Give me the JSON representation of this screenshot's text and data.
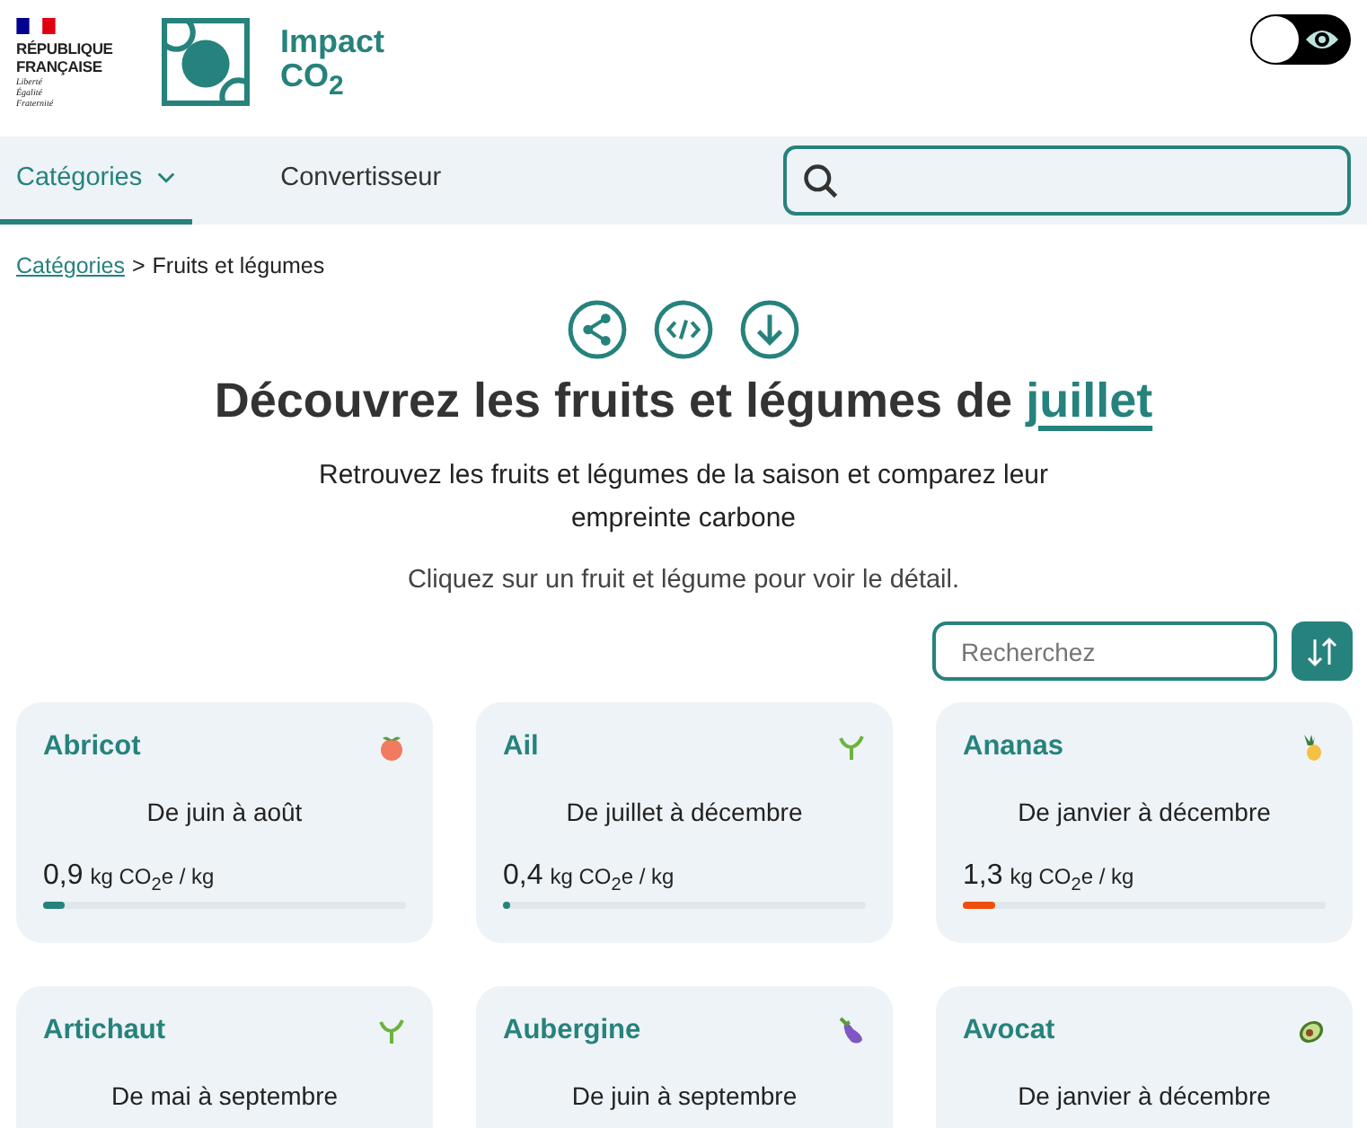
{
  "header": {
    "gov_logo": {
      "lines": [
        "RÉPUBLIQUE",
        "FRANÇAISE"
      ],
      "motto": [
        "Liberté",
        "Égalité",
        "Fraternité"
      ]
    },
    "site_name": {
      "line1": "Impact",
      "line2": "CO$_{2}$"
    },
    "contrast_toggle": {
      "on": false
    }
  },
  "nav": {
    "tabs": [
      {
        "label": "Catégories",
        "selected": true,
        "dropdown": true
      },
      {
        "label": "Convertisseur",
        "selected": false,
        "dropdown": false
      }
    ]
  },
  "breadcrumb": {
    "link": "Catégories",
    "separator": ">",
    "current": "Fruits et légumes"
  },
  "title": {
    "text": "Découvrez les fruits et légumes de",
    "month": "juillet"
  },
  "subtitle": "Retrouvez les fruits et légumes de la saison et comparez leur empreinte carbone",
  "hint": "Cliquez sur un fruit et légume pour voir le détail.",
  "filter": {
    "placeholder": "Recherchez"
  },
  "items": [
    {
      "name": "Abricot",
      "season": "De juin à août",
      "value": "0,9",
      "unit": "kg CO$_{2}$e / kg",
      "level": 0.06,
      "color": "#26827c"
    },
    {
      "name": "Ail",
      "season": "De juillet à décembre",
      "value": "0,4",
      "unit": "kg CO$_{2}$e / kg",
      "level": 0.02,
      "color": "#26827c"
    },
    {
      "name": "Ananas",
      "season": "De janvier à décembre",
      "value": "1,3",
      "unit": "kg CO$_{2}$e / kg",
      "level": 0.09,
      "color": "#f04e0a"
    },
    {
      "name": "Artichaut",
      "season": "De mai à septembre"
    },
    {
      "name": "Aubergine",
      "season": "De juin à septembre"
    },
    {
      "name": "Avocat",
      "season": "De janvier à décembre"
    }
  ]
}
